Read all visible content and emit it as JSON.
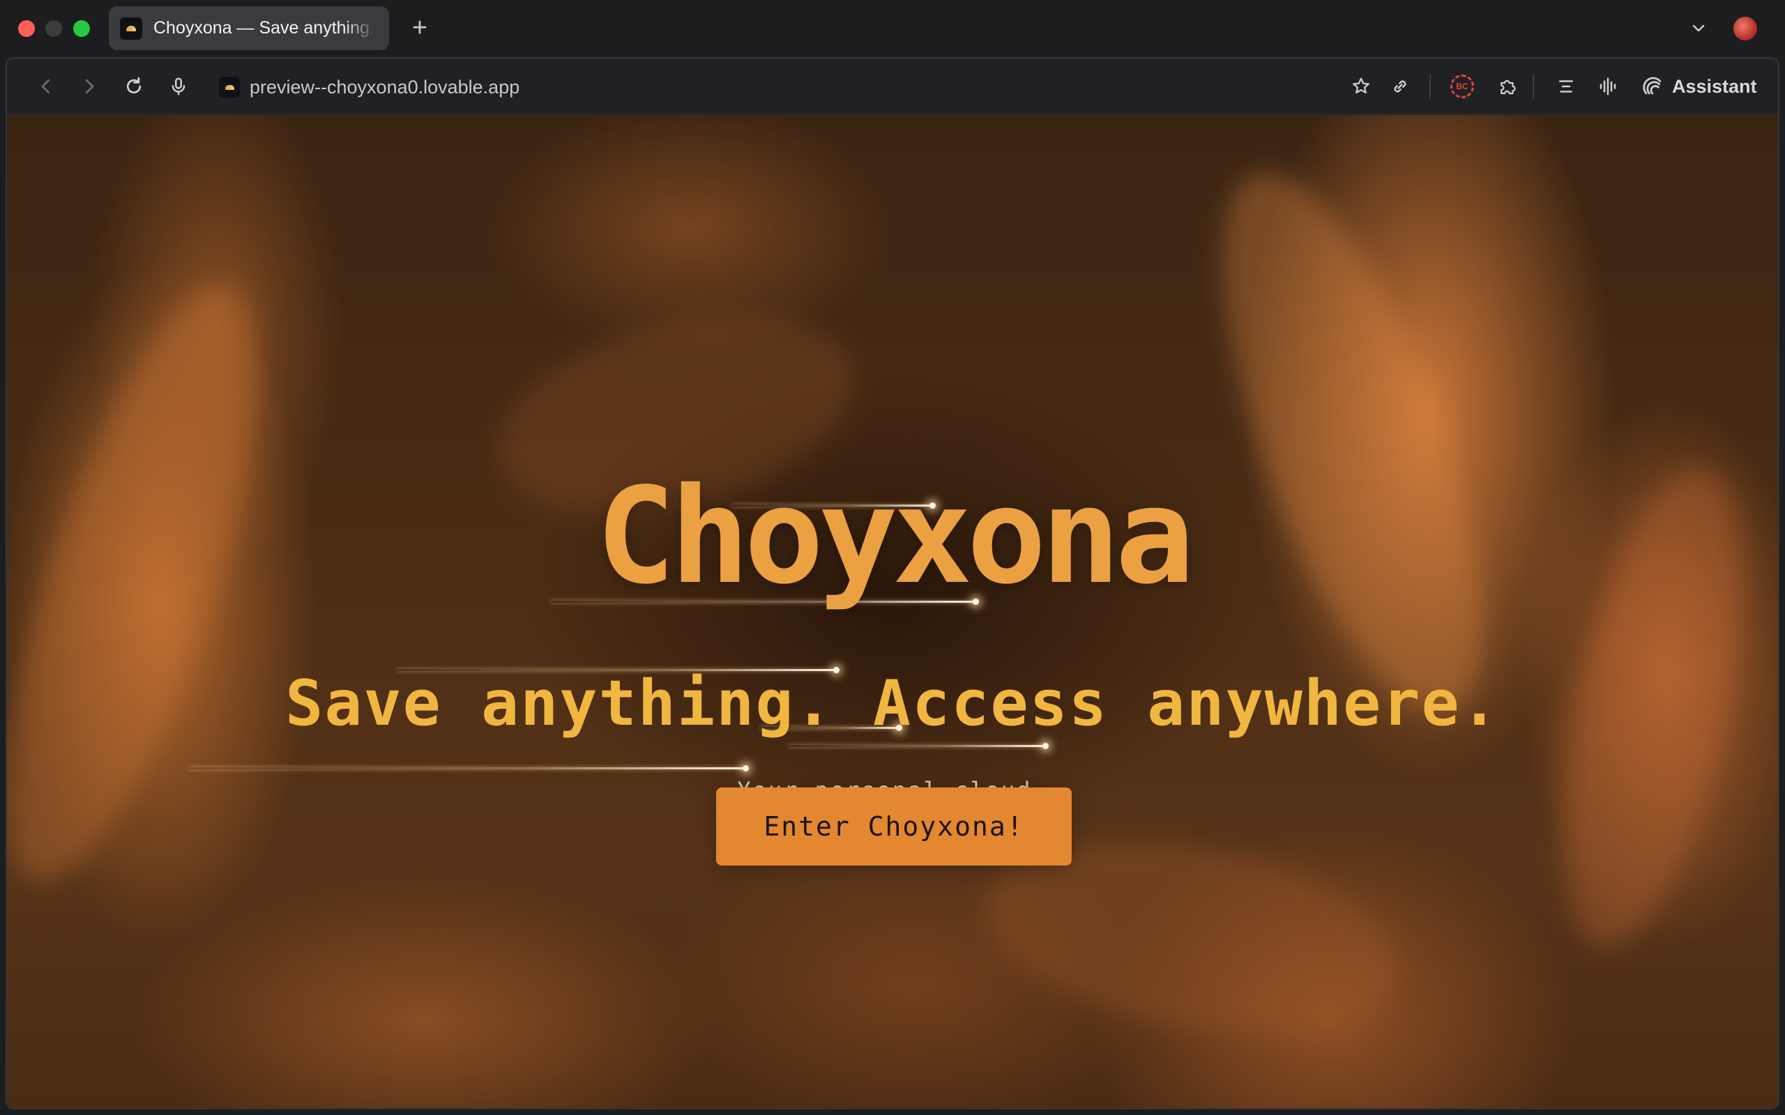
{
  "browser": {
    "tab": {
      "title": "Choyxona — Save anything. Access anywhere."
    },
    "new_tab_label": "+",
    "address_bar": {
      "url": "preview--choyxona0.lovable.app"
    },
    "extension_badge": "BC",
    "assistant_label": "Assistant",
    "icons": {
      "back": "chevron-left-icon",
      "forward": "chevron-right-icon",
      "reload": "reload-icon",
      "mic": "microphone-icon",
      "bookmark": "star-icon",
      "share": "link-icon",
      "extensions": "puzzle-icon",
      "reading": "reading-list-icon",
      "audio": "waveform-icon"
    }
  },
  "page": {
    "title": "Choyxona",
    "subtitle": "Save anything. Access anywhere.",
    "tagline": "Your personal cloud.",
    "cta_label": "Enter Choyxona!"
  },
  "colors": {
    "title": "#eba042",
    "subtitle": "#f1b640",
    "cta_background": "#e48731",
    "browser_chrome": "#202124"
  }
}
